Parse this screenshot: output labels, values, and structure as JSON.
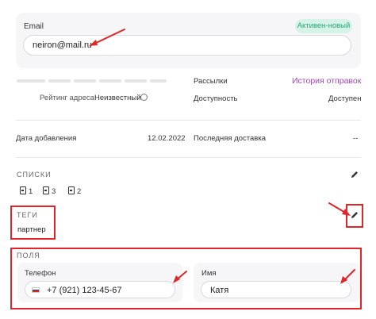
{
  "email": {
    "label": "Email",
    "value": "neiron@mail.ru",
    "status_badge": "Активен-новый"
  },
  "rating": {
    "label": "Рейтинг адреса:",
    "value": "Неизвестный"
  },
  "mailings": {
    "label": "Рассылки",
    "link": "История отправок"
  },
  "availability": {
    "label": "Доступность",
    "value": "Доступен"
  },
  "added": {
    "label": "Дата добавления",
    "value": "12.02.2022"
  },
  "last_delivery": {
    "label": "Последняя доставка",
    "value": "--"
  },
  "lists": {
    "title": "СПИСКИ",
    "items": [
      {
        "icon": "list-icon",
        "count": "1"
      },
      {
        "icon": "list-icon",
        "count": "3"
      },
      {
        "icon": "list-icon",
        "count": "2"
      }
    ]
  },
  "tags": {
    "title": "ТЕГИ",
    "items": [
      "партнер"
    ]
  },
  "fields": {
    "title": "ПОЛЯ",
    "phone": {
      "label": "Телефон",
      "value": "+7 (921) 123-45-67"
    },
    "name": {
      "label": "Имя",
      "value": "Катя"
    }
  },
  "colors": {
    "accent": "#a04bb4",
    "badge_bg": "#d6f3e8",
    "badge_text": "#2aa57a",
    "annotation_red": "#e0262b"
  }
}
